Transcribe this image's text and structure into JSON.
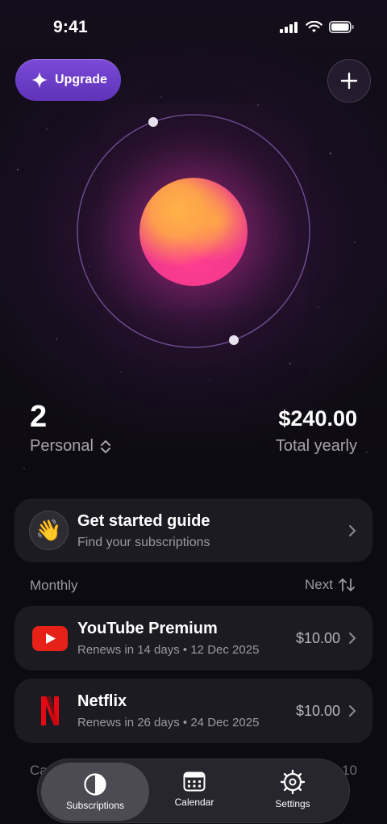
{
  "status_bar": {
    "time": "9:41"
  },
  "header": {
    "upgrade_label": "Upgrade"
  },
  "summary": {
    "count": "2",
    "profile": "Personal",
    "total": "$240.00",
    "total_label": "Total yearly"
  },
  "guide": {
    "title": "Get started guide",
    "subtitle": "Find your subscriptions",
    "icon": "👋"
  },
  "list": {
    "section": "Monthly",
    "sort": "Next",
    "items": [
      {
        "name": "YouTube Premium",
        "renews": "Renews in 14 days",
        "date": "12 Dec 2025",
        "price": "$10.00",
        "logo": "youtube-logo"
      },
      {
        "name": "Netflix",
        "renews": "Renews in 26 days",
        "date": "24 Dec 2025",
        "price": "$10.00",
        "logo": "netflix-logo"
      }
    ],
    "peek_left": "Ca",
    "peek_right": "10"
  },
  "colors": {
    "accent": "#6a3ccc",
    "card": "#1d1b22",
    "youtube": "#e62117",
    "netflix": "#e50914"
  },
  "tabs": [
    {
      "label": "Subscriptions",
      "icon": "half-circle-icon"
    },
    {
      "label": "Calendar",
      "icon": "calendar-icon"
    },
    {
      "label": "Settings",
      "icon": "gear-icon"
    }
  ]
}
